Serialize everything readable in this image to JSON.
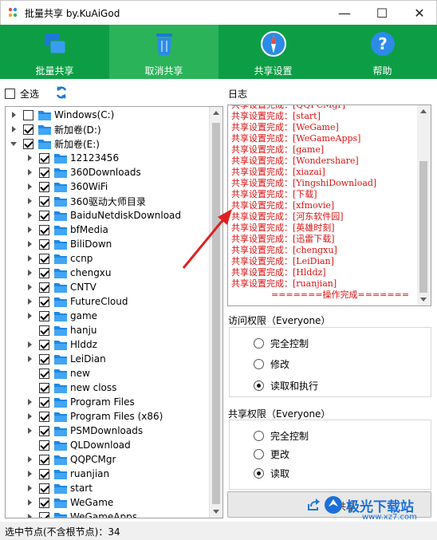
{
  "window": {
    "title": "批量共享 by.KuAiGod",
    "minimize_glyph": "—",
    "maximize_glyph": "☐",
    "close_glyph": "✕"
  },
  "toolbar": {
    "items": [
      {
        "label": "批量共享",
        "icon": "windows-share-icon",
        "active": false
      },
      {
        "label": "取消共享",
        "icon": "trash-icon",
        "active": true
      },
      {
        "label": "共享设置",
        "icon": "compass-icon",
        "active": false
      },
      {
        "label": "帮助",
        "icon": "help-icon",
        "active": false
      }
    ],
    "colors": {
      "bar": "#0d9e45",
      "active": "#2bb35a"
    }
  },
  "left": {
    "select_all_label": "全选",
    "select_all_checked": false,
    "tree": [
      {
        "label": "Windows(C:)",
        "level": 0,
        "expander": "collapsed",
        "checked": false
      },
      {
        "label": "新加卷(D:)",
        "level": 0,
        "expander": "collapsed",
        "checked": true
      },
      {
        "label": "新加卷(E:)",
        "level": 0,
        "expander": "expanded",
        "checked": true
      },
      {
        "label": "12123456",
        "level": 1,
        "expander": "collapsed",
        "checked": true
      },
      {
        "label": "360Downloads",
        "level": 1,
        "expander": "collapsed",
        "checked": true
      },
      {
        "label": "360WiFi",
        "level": 1,
        "expander": "collapsed",
        "checked": true
      },
      {
        "label": "360驱动大师目录",
        "level": 1,
        "expander": "collapsed",
        "checked": true
      },
      {
        "label": "BaiduNetdiskDownload",
        "level": 1,
        "expander": "collapsed",
        "checked": true
      },
      {
        "label": "bfMedia",
        "level": 1,
        "expander": "collapsed",
        "checked": true
      },
      {
        "label": "BiliDown",
        "level": 1,
        "expander": "collapsed",
        "checked": true
      },
      {
        "label": "ccnp",
        "level": 1,
        "expander": "collapsed",
        "checked": true
      },
      {
        "label": "chengxu",
        "level": 1,
        "expander": "collapsed",
        "checked": true
      },
      {
        "label": "CNTV",
        "level": 1,
        "expander": "collapsed",
        "checked": true
      },
      {
        "label": "FutureCloud",
        "level": 1,
        "expander": "collapsed",
        "checked": true
      },
      {
        "label": "game",
        "level": 1,
        "expander": "collapsed",
        "checked": true
      },
      {
        "label": "hanju",
        "level": 1,
        "expander": "none",
        "checked": true
      },
      {
        "label": "Hlddz",
        "level": 1,
        "expander": "collapsed",
        "checked": true
      },
      {
        "label": "LeiDian",
        "level": 1,
        "expander": "collapsed",
        "checked": true
      },
      {
        "label": "new",
        "level": 1,
        "expander": "none",
        "checked": true
      },
      {
        "label": "new closs",
        "level": 1,
        "expander": "none",
        "checked": true
      },
      {
        "label": "Program Files",
        "level": 1,
        "expander": "collapsed",
        "checked": true
      },
      {
        "label": "Program Files (x86)",
        "level": 1,
        "expander": "collapsed",
        "checked": true
      },
      {
        "label": "PSMDownloads",
        "level": 1,
        "expander": "collapsed",
        "checked": true
      },
      {
        "label": "QLDownload",
        "level": 1,
        "expander": "none",
        "checked": true
      },
      {
        "label": "QQPCMgr",
        "level": 1,
        "expander": "collapsed",
        "checked": true
      },
      {
        "label": "ruanjian",
        "level": 1,
        "expander": "collapsed",
        "checked": true
      },
      {
        "label": "start",
        "level": 1,
        "expander": "collapsed",
        "checked": true
      },
      {
        "label": "WeGame",
        "level": 1,
        "expander": "collapsed",
        "checked": true
      },
      {
        "label": "WeGameApps",
        "level": 1,
        "expander": "collapsed",
        "checked": true
      }
    ],
    "status": "选中节点(不含根节点)：34"
  },
  "log": {
    "label": "日志",
    "prefix": "共享设置完成：",
    "lines": [
      "[QQPCMgr]",
      "[start]",
      "[WeGame]",
      "[WeGameApps]",
      "[game]",
      "[Wondershare]",
      "[xiazai]",
      "[YingshiDownload]",
      "[下载]",
      "[xfmovie]",
      "[河东软件园]",
      "[英雄时刻]",
      "[迅雷下载]",
      "[chengxu]",
      "[LeiDian]",
      "[Hlddz]",
      "[ruanjian]"
    ],
    "footer": "=======操作完成=======",
    "color": "#dd1111"
  },
  "access": {
    "label": "访问权限（Everyone）",
    "options": [
      "完全控制",
      "修改",
      "读取和执行"
    ],
    "selected": 2
  },
  "share_perm": {
    "label": "共享权限（Everyone）",
    "options": [
      "完全控制",
      "更改",
      "读取"
    ],
    "selected": 2
  },
  "share_button": {
    "label": "共享"
  },
  "watermark": {
    "text": "极光下载站",
    "url": "www.xz7.com"
  }
}
